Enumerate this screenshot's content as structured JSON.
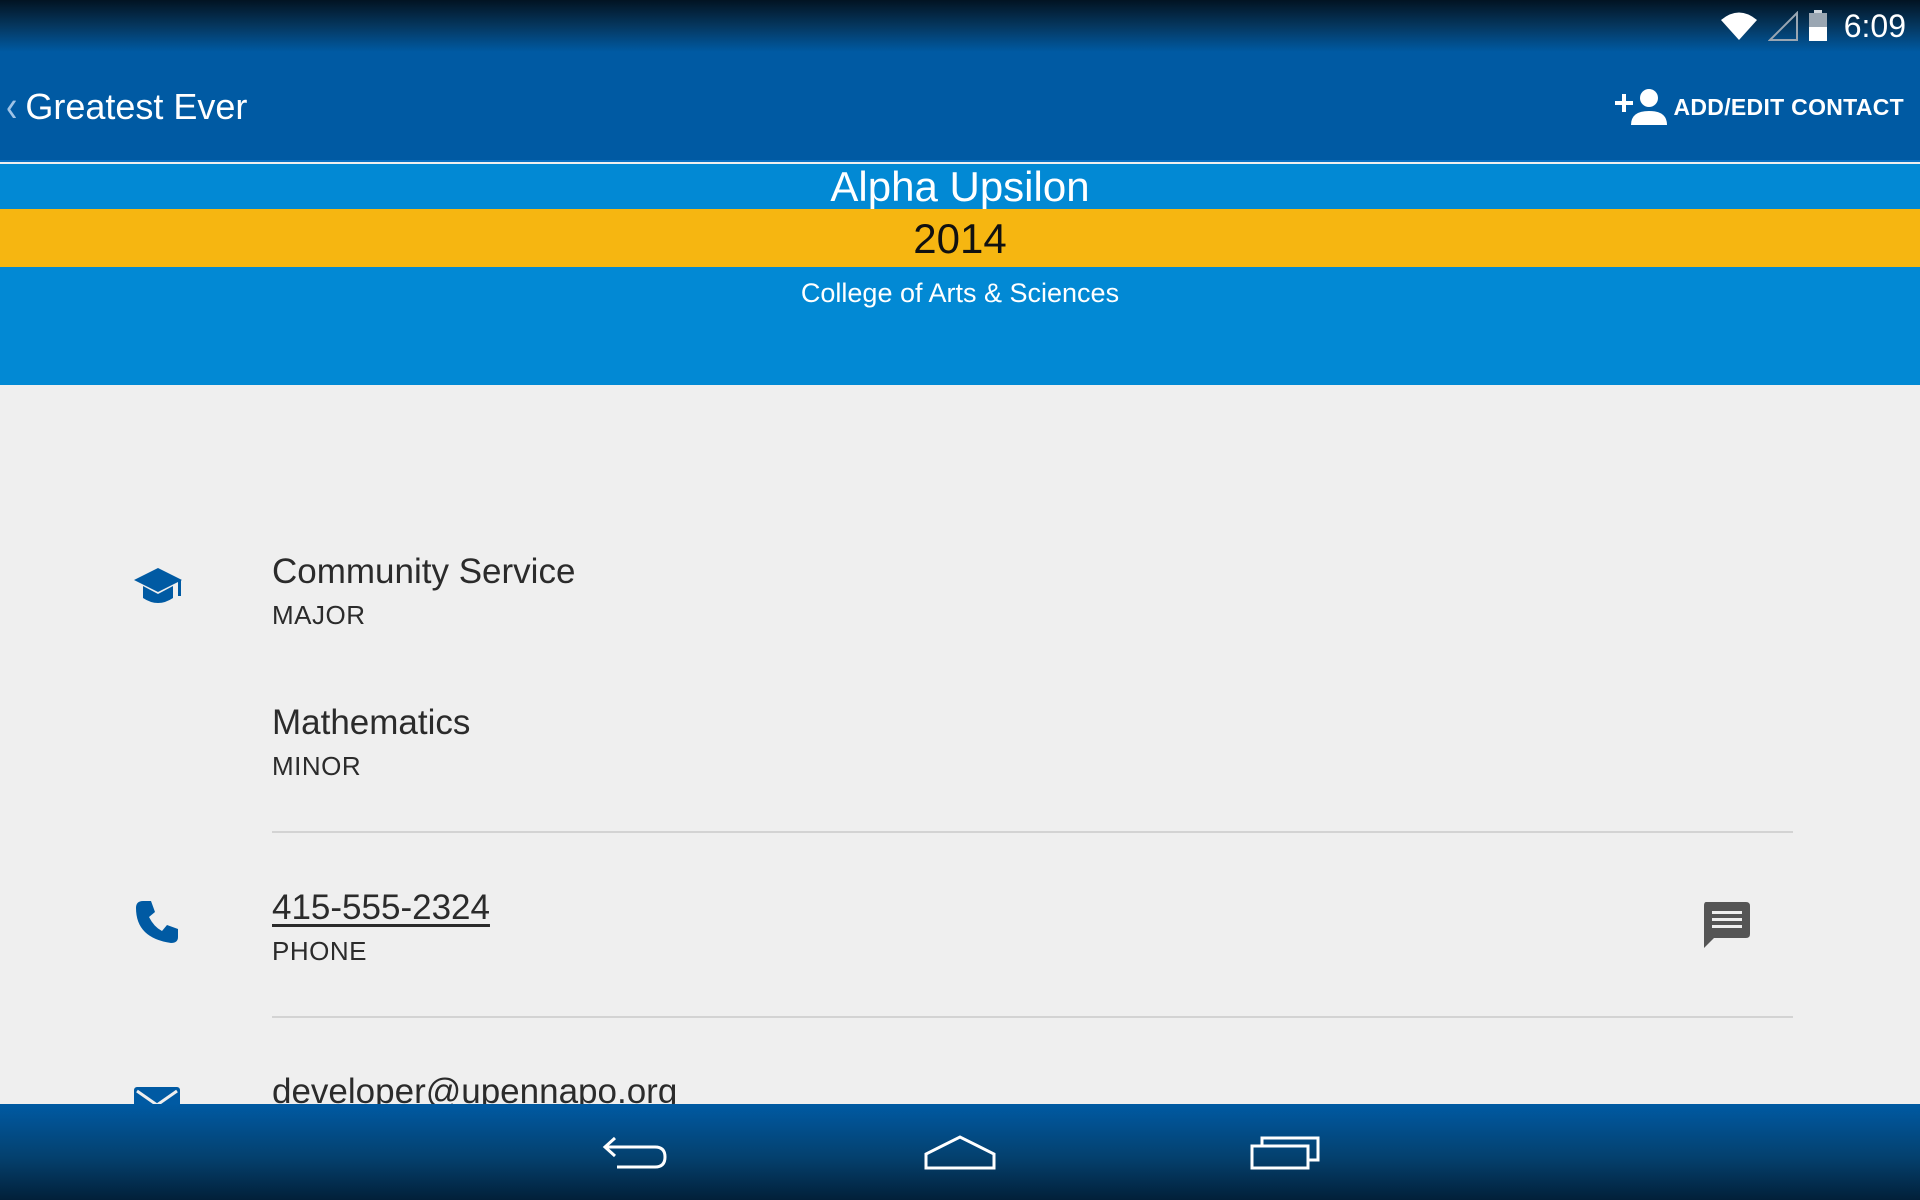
{
  "status_bar": {
    "time": "6:09",
    "icons": [
      "wifi-icon",
      "signal-icon",
      "battery-icon"
    ]
  },
  "action_bar": {
    "back_title": "Greatest Ever",
    "add_edit_label": "ADD/EDIT CONTACT",
    "add_edit_icon": "add-person-icon"
  },
  "header": {
    "org_name": "Alpha Upsilon",
    "year": "2014",
    "college": "College of Arts & Sciences"
  },
  "education": {
    "icon": "graduation-cap-icon",
    "major_value": "Community Service",
    "major_label": "MAJOR",
    "minor_value": "Mathematics",
    "minor_label": "MINOR"
  },
  "phone": {
    "icon": "phone-icon",
    "value": "415-555-2324",
    "label": "PHONE",
    "action_icon": "message-icon"
  },
  "email": {
    "icon": "email-icon",
    "value": "developer@upennapo.org"
  },
  "nav_bar": {
    "buttons": [
      "back-icon",
      "home-icon",
      "recent-apps-icon"
    ]
  },
  "colors": {
    "action_bar": "#005aa3",
    "header_blue": "#0289d4",
    "year_gold": "#f6b611",
    "icon_blue": "#005aa3",
    "background": "#efefef"
  }
}
